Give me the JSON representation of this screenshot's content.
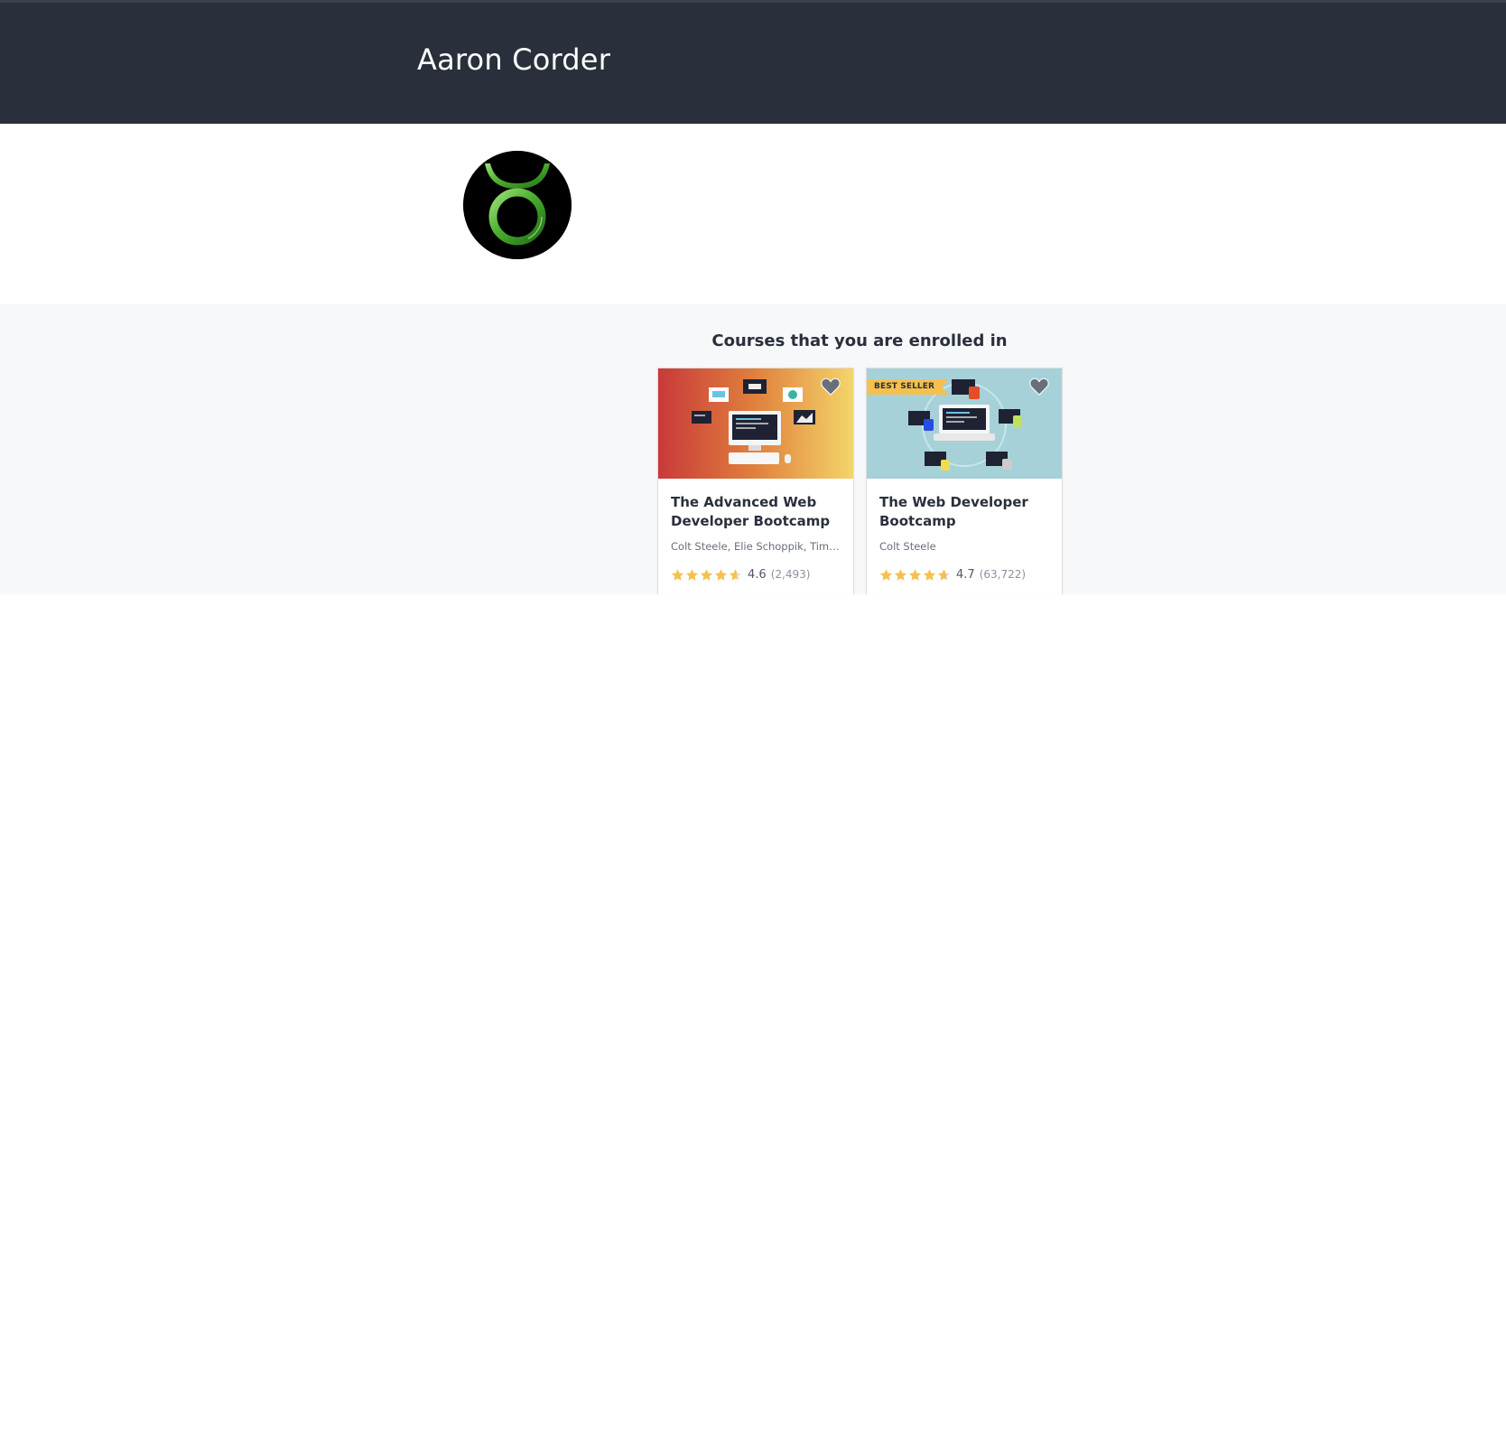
{
  "header": {
    "title": "Aaron Corder"
  },
  "profile": {
    "avatar_icon": "taurus-symbol-icon"
  },
  "courses": {
    "heading": "Courses that you are enrolled in",
    "items": [
      {
        "title": "The Advanced Web Developer Bootcamp",
        "authors": "Colt Steele, Elie Schoppik, Tim Garcia",
        "rating": "4.6",
        "rating_count": "(2,493)",
        "stars": 4.6,
        "badge": ""
      },
      {
        "title": "The Web Developer Bootcamp",
        "authors": "Colt Steele",
        "rating": "4.7",
        "rating_count": "(63,722)",
        "stars": 4.7,
        "badge": "BEST SELLER"
      }
    ]
  },
  "colors": {
    "header_bg": "#29303b",
    "section_bg": "#f7f8fa",
    "star": "#f4c150",
    "badge": "#f4c150",
    "avatar_ring": "#4caf2f"
  }
}
